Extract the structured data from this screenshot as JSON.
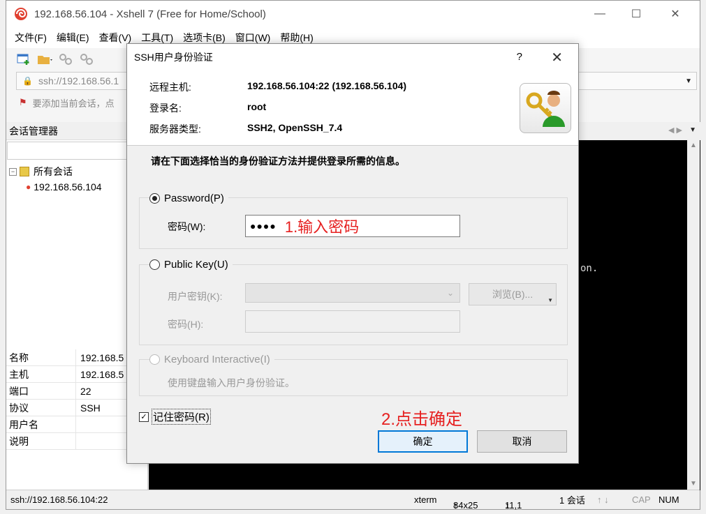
{
  "window": {
    "title": "192.168.56.104 - Xshell 7 (Free for Home/School)",
    "min": "—",
    "max": "☐",
    "close": "✕"
  },
  "menu": [
    "文件(F)",
    "编辑(E)",
    "查看(V)",
    "工具(T)",
    "选项卡(B)",
    "窗口(W)",
    "帮助(H)"
  ],
  "address": {
    "value": "ssh://192.168.56.1"
  },
  "hint": {
    "text": "要添加当前会话，点"
  },
  "session_manager": {
    "title": "会话管理器",
    "pin": "",
    "tree": [
      {
        "label": "所有会话",
        "level": 0
      },
      {
        "label": "192.168.56.104",
        "level": 1
      }
    ]
  },
  "properties": [
    {
      "key": "名称",
      "value": "192.168.5"
    },
    {
      "key": "主机",
      "value": "192.168.5"
    },
    {
      "key": "端口",
      "value": "22"
    },
    {
      "key": "协议",
      "value": "SSH"
    },
    {
      "key": "用户名",
      "value": ""
    },
    {
      "key": "说明",
      "value": ""
    }
  ],
  "terminal": {
    "visible_text": "on."
  },
  "status": {
    "url": "ssh://192.168.56.104:22",
    "term": "xterm",
    "size": "84x25",
    "cursor": "11,1",
    "sessions": "1 会话",
    "cap": "CAP",
    "num": "NUM"
  },
  "dialog": {
    "title": "SSH用户身份验证",
    "help": "?",
    "close": "✕",
    "info": {
      "remote_host_label": "远程主机:",
      "remote_host_value": "192.168.56.104:22 (192.168.56.104)",
      "login_label": "登录名:",
      "login_value": "root",
      "server_type_label": "服务器类型:",
      "server_type_value": "SSH2, OpenSSH_7.4"
    },
    "instruction": "请在下面选择恰当的身份验证方法并提供登录所需的信息。",
    "password": {
      "label": "Password(P)",
      "field_label": "密码(W):",
      "value": "●●●●",
      "annotation": "1.输入密码"
    },
    "public_key": {
      "label": "Public Key(U)",
      "user_key_label": "用户密钥(K):",
      "browse_label": "浏览(B)...",
      "passphrase_label": "密码(H):"
    },
    "keyboard": {
      "label": "Keyboard Interactive(I)",
      "description": "使用键盘输入用户身份验证。"
    },
    "remember": {
      "label": "记住密码(R)",
      "checked": true
    },
    "annotation2": "2.点击确定",
    "ok_label": "确定",
    "cancel_label": "取消"
  }
}
